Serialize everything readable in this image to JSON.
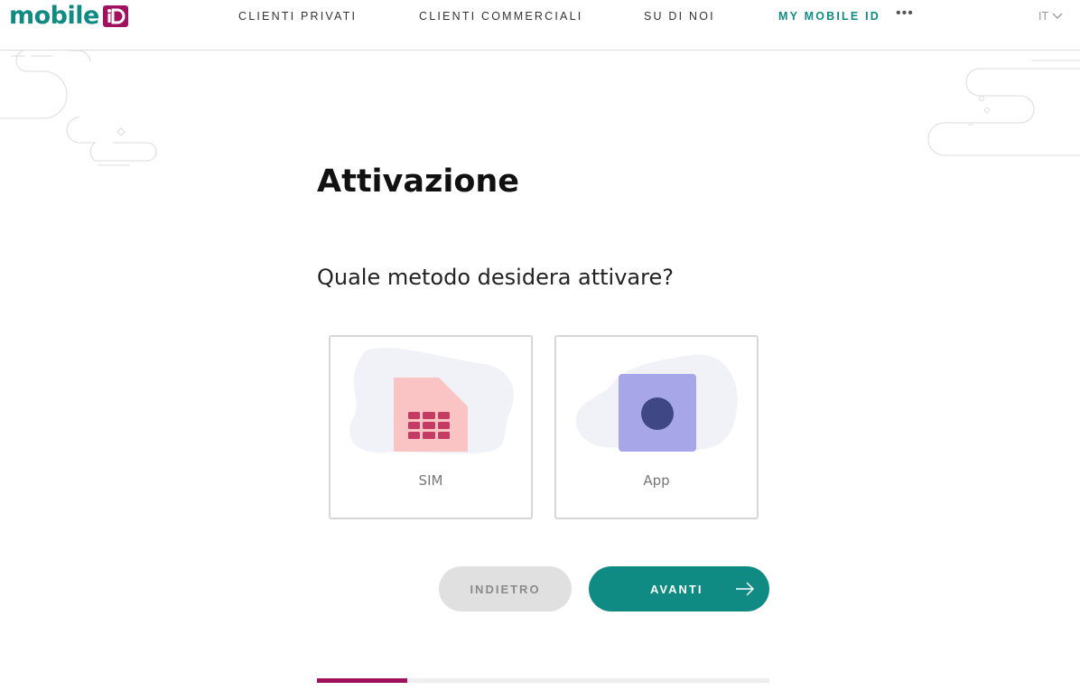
{
  "header": {
    "logo_text": "mobile",
    "nav": [
      {
        "label": "CLIENTI PRIVATI"
      },
      {
        "label": "CLIENTI COMMERCIALI"
      },
      {
        "label": "SU DI NOI"
      },
      {
        "label": "MY MOBILE ID"
      }
    ],
    "more_label": "•••",
    "language": "IT"
  },
  "main": {
    "title": "Attivazione",
    "question": "Quale metodo desidera attivare?",
    "options": [
      {
        "label": "SIM",
        "icon": "sim-card-icon"
      },
      {
        "label": "App",
        "icon": "app-icon"
      }
    ]
  },
  "actions": {
    "back_label": "INDIETRO",
    "next_label": "AVANTI"
  },
  "progress": {
    "fraction": 0.2
  },
  "colors": {
    "brand_teal": "#0f8b83",
    "brand_magenta": "#a0115e",
    "sim_pink": "#fbc4c4",
    "sim_chip": "#c43c64",
    "app_purple": "#a7a6e8",
    "app_dot": "#3f4784"
  }
}
